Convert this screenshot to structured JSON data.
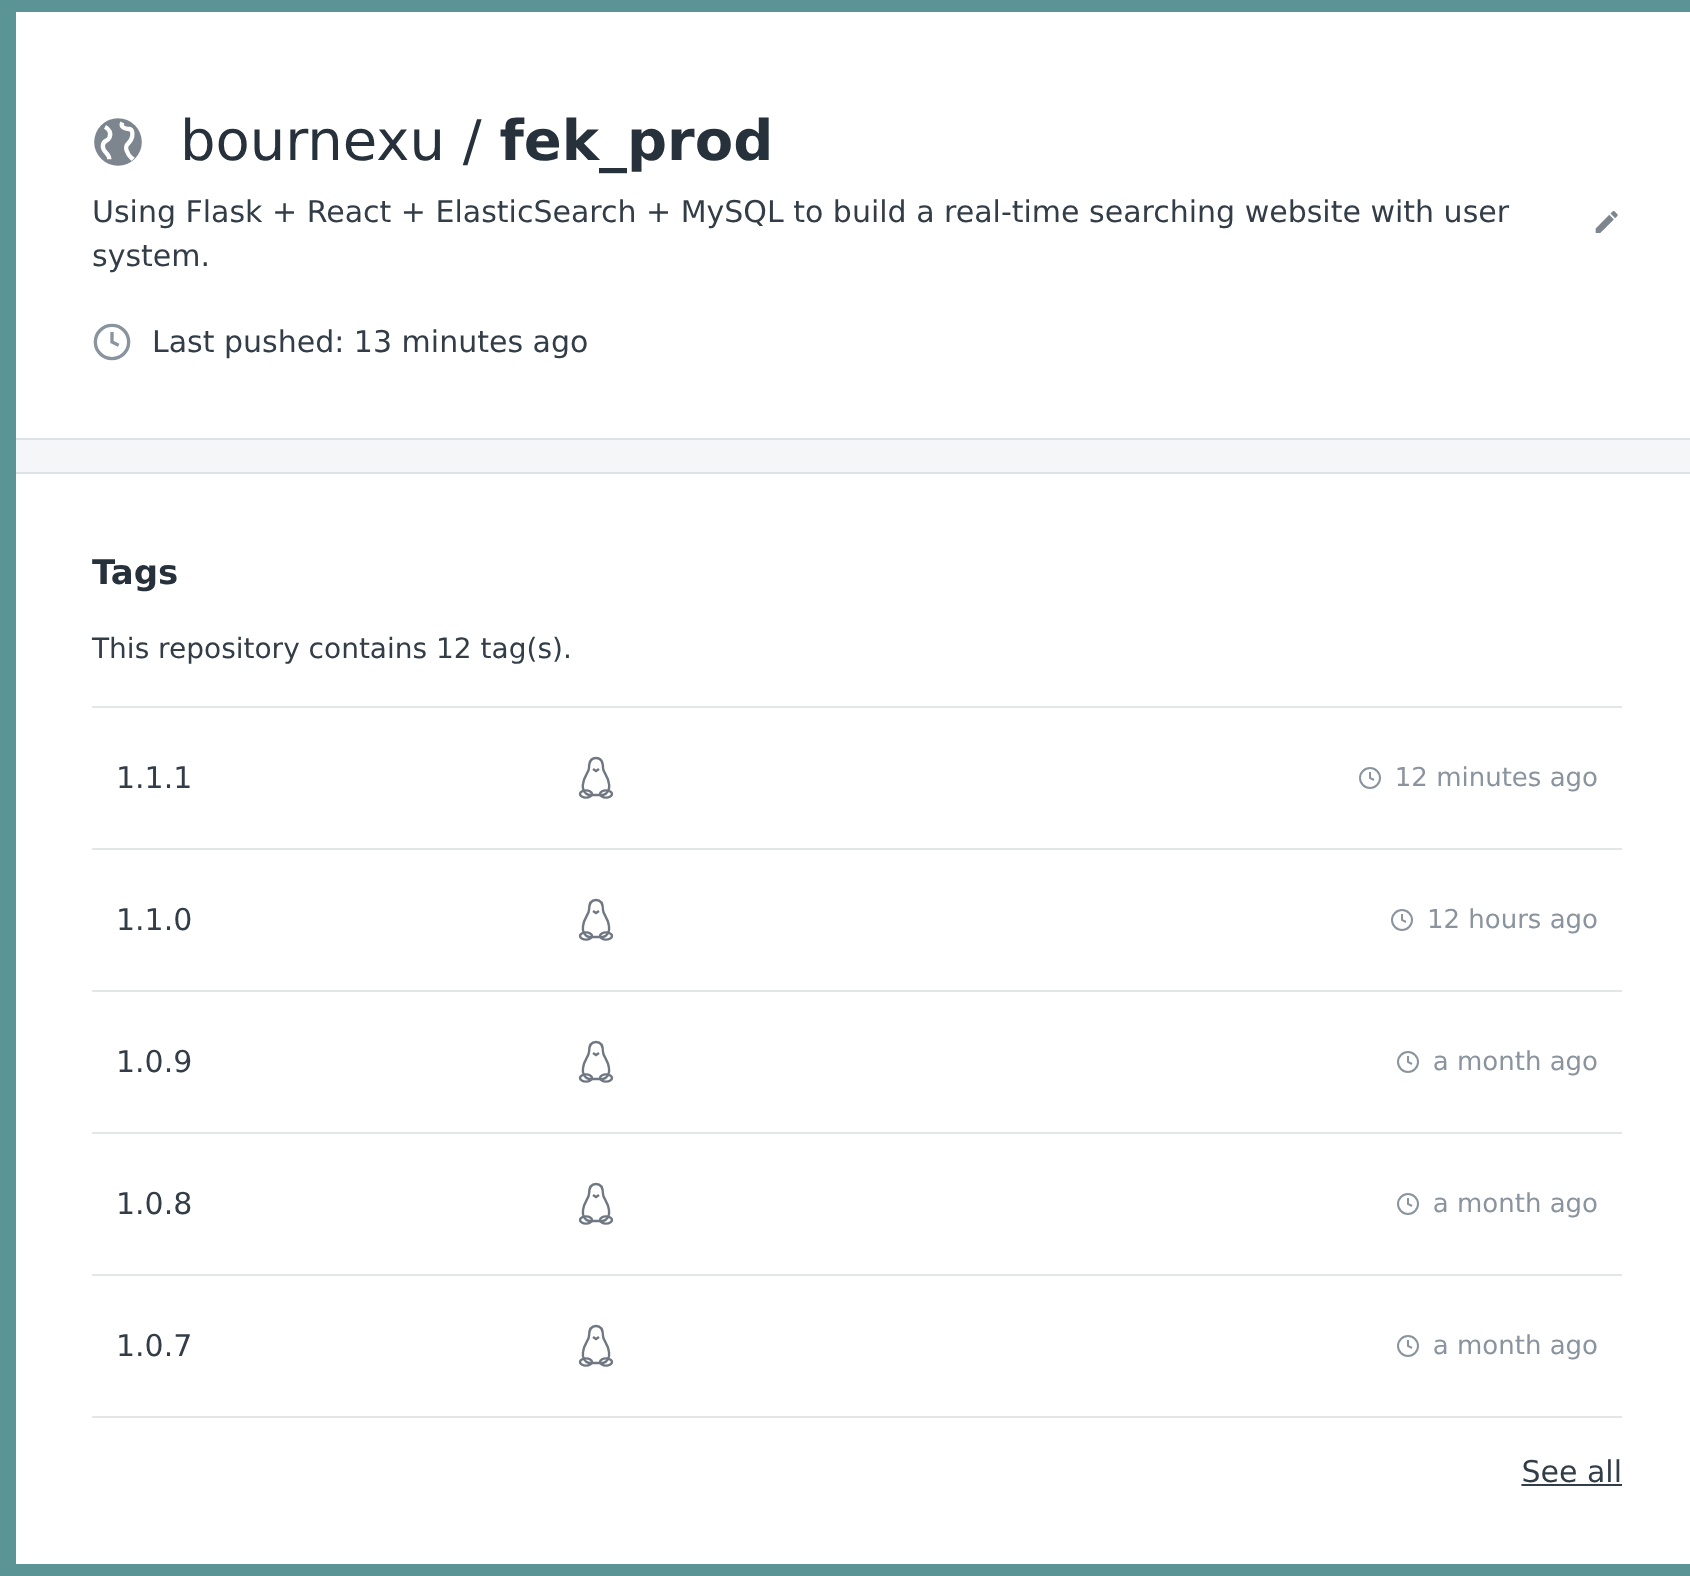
{
  "repository": {
    "owner": "bournexu",
    "separator": "/",
    "name": "fek_prod",
    "description": "Using Flask + React + ElasticSearch + MySQL to build a real-time searching website with user system.",
    "last_pushed": "Last pushed: 13 minutes ago"
  },
  "tags": {
    "title": "Tags",
    "summary": "This repository contains 12 tag(s).",
    "rows": [
      {
        "name": "1.1.1",
        "time": "12 minutes ago"
      },
      {
        "name": "1.1.0",
        "time": "12 hours ago"
      },
      {
        "name": "1.0.9",
        "time": "a month ago"
      },
      {
        "name": "1.0.8",
        "time": "a month ago"
      },
      {
        "name": "1.0.7",
        "time": "a month ago"
      }
    ],
    "see_all": "See all"
  }
}
